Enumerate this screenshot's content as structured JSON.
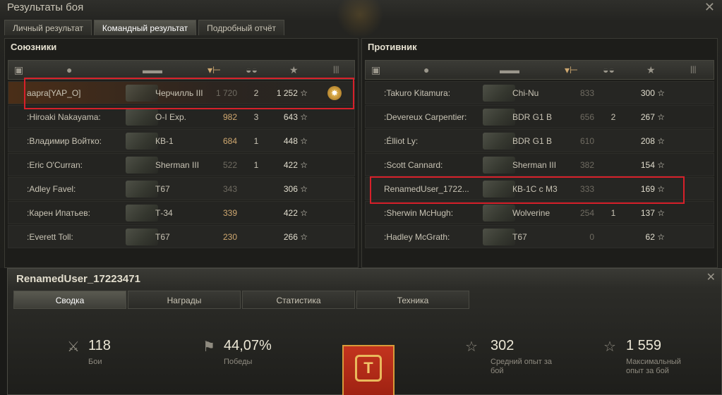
{
  "window": {
    "title": "Результаты боя",
    "tabs": [
      "Личный результат",
      "Командный результат",
      "Подробный отчёт"
    ],
    "active_tab": 1
  },
  "allies": {
    "title": "Союзники",
    "rows": [
      {
        "name": "aapra[YAP_O]",
        "tank": "Черчилль III",
        "damage": "1 720",
        "kills": "2",
        "xp": "1 252",
        "medal": true,
        "highlight": true,
        "dmg_style": "gray"
      },
      {
        "name": ":Hiroaki Nakayama:",
        "tank": "O-I Exp.",
        "damage": "982",
        "kills": "3",
        "xp": "643",
        "dmg_style": "tan"
      },
      {
        "name": ":Владимир Войтко:",
        "tank": "КВ-1",
        "damage": "684",
        "kills": "1",
        "xp": "448",
        "dmg_style": "tan"
      },
      {
        "name": ":Eric O'Curran:",
        "tank": "Sherman III",
        "damage": "522",
        "kills": "1",
        "xp": "422",
        "dmg_style": "gray"
      },
      {
        "name": ":Adley Favel:",
        "tank": "T67",
        "damage": "343",
        "kills": "",
        "xp": "306",
        "dmg_style": "gray"
      },
      {
        "name": ":Карен Ипатьев:",
        "tank": "Т-34",
        "damage": "339",
        "kills": "",
        "xp": "422",
        "dmg_style": "tan"
      },
      {
        "name": ":Everett Toll:",
        "tank": "T67",
        "damage": "230",
        "kills": "",
        "xp": "266",
        "dmg_style": "tan"
      }
    ]
  },
  "enemies": {
    "title": "Противник",
    "rows": [
      {
        "name": ":Takuro Kitamura:",
        "tank": "Chi-Nu",
        "damage": "833",
        "kills": "",
        "xp": "300",
        "dmg_style": "gray"
      },
      {
        "name": ":Devereux Carpentier:",
        "tank": "BDR G1 B",
        "damage": "656",
        "kills": "2",
        "xp": "267",
        "dmg_style": "gray"
      },
      {
        "name": ":Élliot Ly:",
        "tank": "BDR G1 B",
        "damage": "610",
        "kills": "",
        "xp": "208",
        "dmg_style": "gray"
      },
      {
        "name": ":Scott Cannard:",
        "tank": "Sherman III",
        "damage": "382",
        "kills": "",
        "xp": "154",
        "dmg_style": "gray"
      },
      {
        "name": "RenamedUser_1722...",
        "tank": "КВ-1С с М3",
        "damage": "333",
        "kills": "",
        "xp": "169",
        "dmg_style": "gray"
      },
      {
        "name": ":Sherwin McHugh:",
        "tank": "Wolverine",
        "damage": "254",
        "kills": "1",
        "xp": "137",
        "dmg_style": "gray"
      },
      {
        "name": ":Hadley McGrath:",
        "tank": "T67",
        "damage": "0",
        "kills": "",
        "xp": "62",
        "dmg_style": "gray"
      }
    ]
  },
  "profile": {
    "title": "RenamedUser_17223471",
    "tabs": [
      "Сводка",
      "Награды",
      "Статистика",
      "Техника"
    ],
    "active_tab": 0,
    "stats": [
      {
        "icon": "crossed-swords-icon",
        "value": "118",
        "label": "Бои"
      },
      {
        "icon": "flag-icon",
        "value": "44,07%",
        "label": "Победы"
      },
      {
        "icon": "star-outline-icon",
        "value": "302",
        "label": "Средний опыт за бой"
      },
      {
        "icon": "star-outline-icon",
        "value": "1 559",
        "label": "Максимальный опыт за бой"
      }
    ]
  },
  "colors": {
    "highlight_box": "#d7202a",
    "damage_tan": "#cfa870",
    "damage_gray": "#6f6b61",
    "banner": "#c3341e"
  }
}
